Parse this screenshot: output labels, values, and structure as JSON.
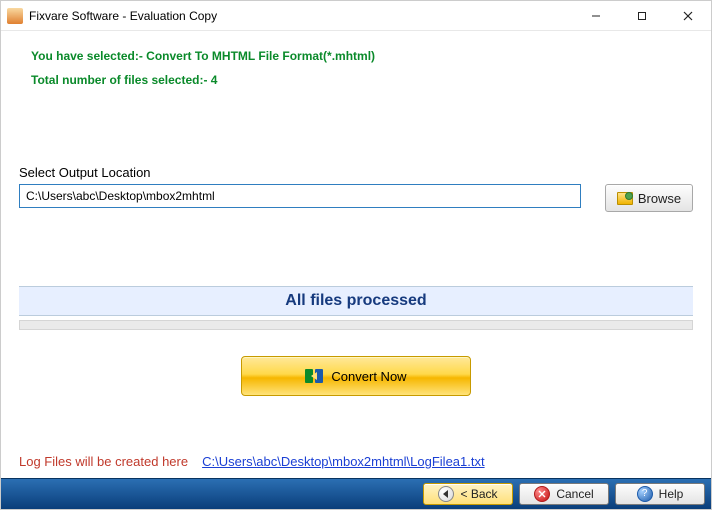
{
  "window": {
    "title": "Fixvare Software - Evaluation Copy"
  },
  "summary": {
    "line1": "You have selected:- Convert To MHTML File Format(*.mhtml)",
    "line2": "Total number of files selected:- 4"
  },
  "output": {
    "label": "Select Output Location",
    "value": "C:\\Users\\abc\\Desktop\\mbox2mhtml",
    "browse_label": "Browse"
  },
  "status": {
    "text": "All files processed"
  },
  "actions": {
    "convert_label": "Convert Now"
  },
  "log": {
    "label": "Log Files will be created here",
    "link": "C:\\Users\\abc\\Desktop\\mbox2mhtml\\LogFilea1.txt"
  },
  "bottom": {
    "back": "< Back",
    "cancel": "Cancel",
    "help": "Help"
  }
}
